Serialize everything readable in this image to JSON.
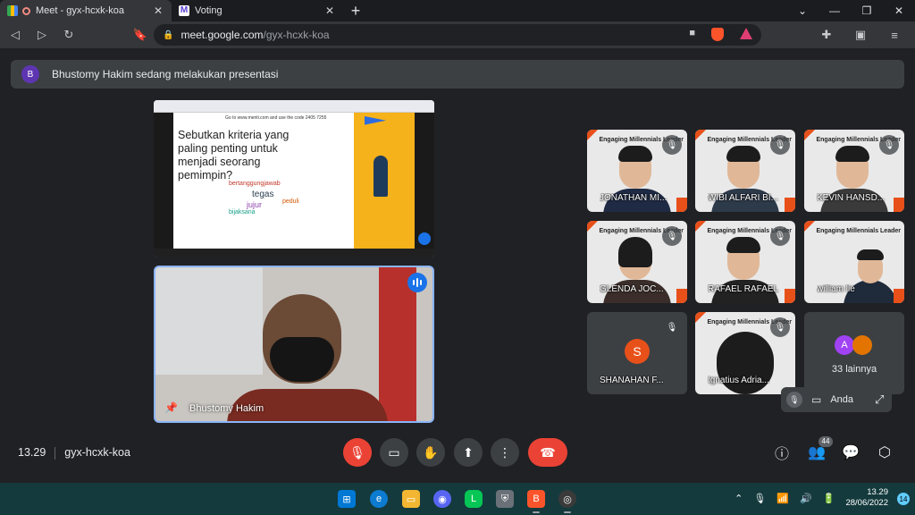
{
  "browser": {
    "tabs": [
      {
        "title": "Meet - gyx-hcxk-koa",
        "active": true
      },
      {
        "title": "Voting",
        "active": false
      }
    ],
    "url_host": "meet.google.com",
    "url_path": "/gyx-hcxk-koa"
  },
  "banner": {
    "avatar_letter": "B",
    "text": "Bhustomy Hakim sedang melakukan presentasi"
  },
  "presentation": {
    "note": "Go to www.menti.com and use the code 2405 7255",
    "question": "Sebutkan kriteria yang paling penting untuk menjadi seorang pemimpin?",
    "words": [
      "tegas",
      "jujur",
      "bertanggungjawab",
      "bijaksana",
      "peduli"
    ]
  },
  "presenter": {
    "name": "Bhustomy Hakim"
  },
  "participants": [
    {
      "name": "JONATHAN MI..."
    },
    {
      "name": "WIBI ALFARI BI..."
    },
    {
      "name": "KEVIN HANSD..."
    },
    {
      "name": "GLENDA JOC..."
    },
    {
      "name": "RAFAEL RAFAEL"
    },
    {
      "name": "william lie"
    },
    {
      "name": "SHANAHAN F...",
      "avatar_letter": "S"
    },
    {
      "name": "Ignatius Adria..."
    }
  ],
  "tile_brand": "Engaging Millennials Leader",
  "more": {
    "avatar_letter": "A",
    "label": "33 lainnya"
  },
  "self": {
    "label": "Anda"
  },
  "meeting": {
    "time": "13.29",
    "code": "gyx-hcxk-koa"
  },
  "people_count": "44",
  "system": {
    "time": "13.29",
    "date": "28/06/2022",
    "notifications": "14"
  },
  "colors": {
    "accent": "#8ab4f8",
    "danger": "#ea4335",
    "meet_bg": "#202124"
  }
}
